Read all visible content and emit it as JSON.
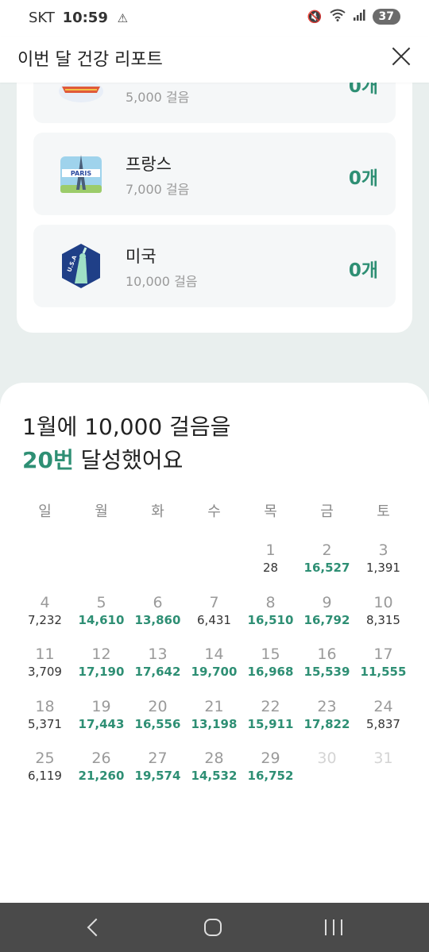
{
  "status_bar": {
    "carrier": "SKT",
    "time": "10:59",
    "battery": "37"
  },
  "header": {
    "title": "이번 달 건강 리포트"
  },
  "countries": [
    {
      "name": "",
      "steps": "5,000 걸음",
      "count": "0개",
      "icon": "airplane-badge-icon"
    },
    {
      "name": "프랑스",
      "steps": "7,000 걸음",
      "count": "0개",
      "icon": "paris-badge-icon"
    },
    {
      "name": "미국",
      "steps": "10,000 걸음",
      "count": "0개",
      "icon": "usa-badge-icon"
    }
  ],
  "summary": {
    "line1": "1월에 10,000 걸음을",
    "count": "20번",
    "line2_rest": " 달성했어요"
  },
  "weekdays": [
    "일",
    "월",
    "화",
    "수",
    "목",
    "금",
    "토"
  ],
  "calendar": {
    "days": [
      {
        "d": "",
        "s": ""
      },
      {
        "d": "",
        "s": ""
      },
      {
        "d": "",
        "s": ""
      },
      {
        "d": "",
        "s": ""
      },
      {
        "d": "1",
        "s": "28"
      },
      {
        "d": "2",
        "s": "16,527",
        "a": true
      },
      {
        "d": "3",
        "s": "1,391"
      },
      {
        "d": "4",
        "s": "7,232"
      },
      {
        "d": "5",
        "s": "14,610",
        "a": true
      },
      {
        "d": "6",
        "s": "13,860",
        "a": true
      },
      {
        "d": "7",
        "s": "6,431"
      },
      {
        "d": "8",
        "s": "16,510",
        "a": true
      },
      {
        "d": "9",
        "s": "16,792",
        "a": true
      },
      {
        "d": "10",
        "s": "8,315"
      },
      {
        "d": "11",
        "s": "3,709"
      },
      {
        "d": "12",
        "s": "17,190",
        "a": true
      },
      {
        "d": "13",
        "s": "17,642",
        "a": true
      },
      {
        "d": "14",
        "s": "19,700",
        "a": true
      },
      {
        "d": "15",
        "s": "16,968",
        "a": true
      },
      {
        "d": "16",
        "s": "15,539",
        "a": true
      },
      {
        "d": "17",
        "s": "11,555",
        "a": true
      },
      {
        "d": "18",
        "s": "5,371"
      },
      {
        "d": "19",
        "s": "17,443",
        "a": true
      },
      {
        "d": "20",
        "s": "16,556",
        "a": true
      },
      {
        "d": "21",
        "s": "13,198",
        "a": true
      },
      {
        "d": "22",
        "s": "15,911",
        "a": true
      },
      {
        "d": "23",
        "s": "17,822",
        "a": true
      },
      {
        "d": "24",
        "s": "5,837"
      },
      {
        "d": "25",
        "s": "6,119"
      },
      {
        "d": "26",
        "s": "21,260",
        "a": true
      },
      {
        "d": "27",
        "s": "19,574",
        "a": true
      },
      {
        "d": "28",
        "s": "14,532",
        "a": true
      },
      {
        "d": "29",
        "s": "16,752",
        "a": true
      },
      {
        "d": "30",
        "s": "",
        "future": true
      },
      {
        "d": "31",
        "s": "",
        "future": true
      }
    ]
  },
  "colors": {
    "accent": "#2e8f74",
    "background": "#e9efee"
  }
}
